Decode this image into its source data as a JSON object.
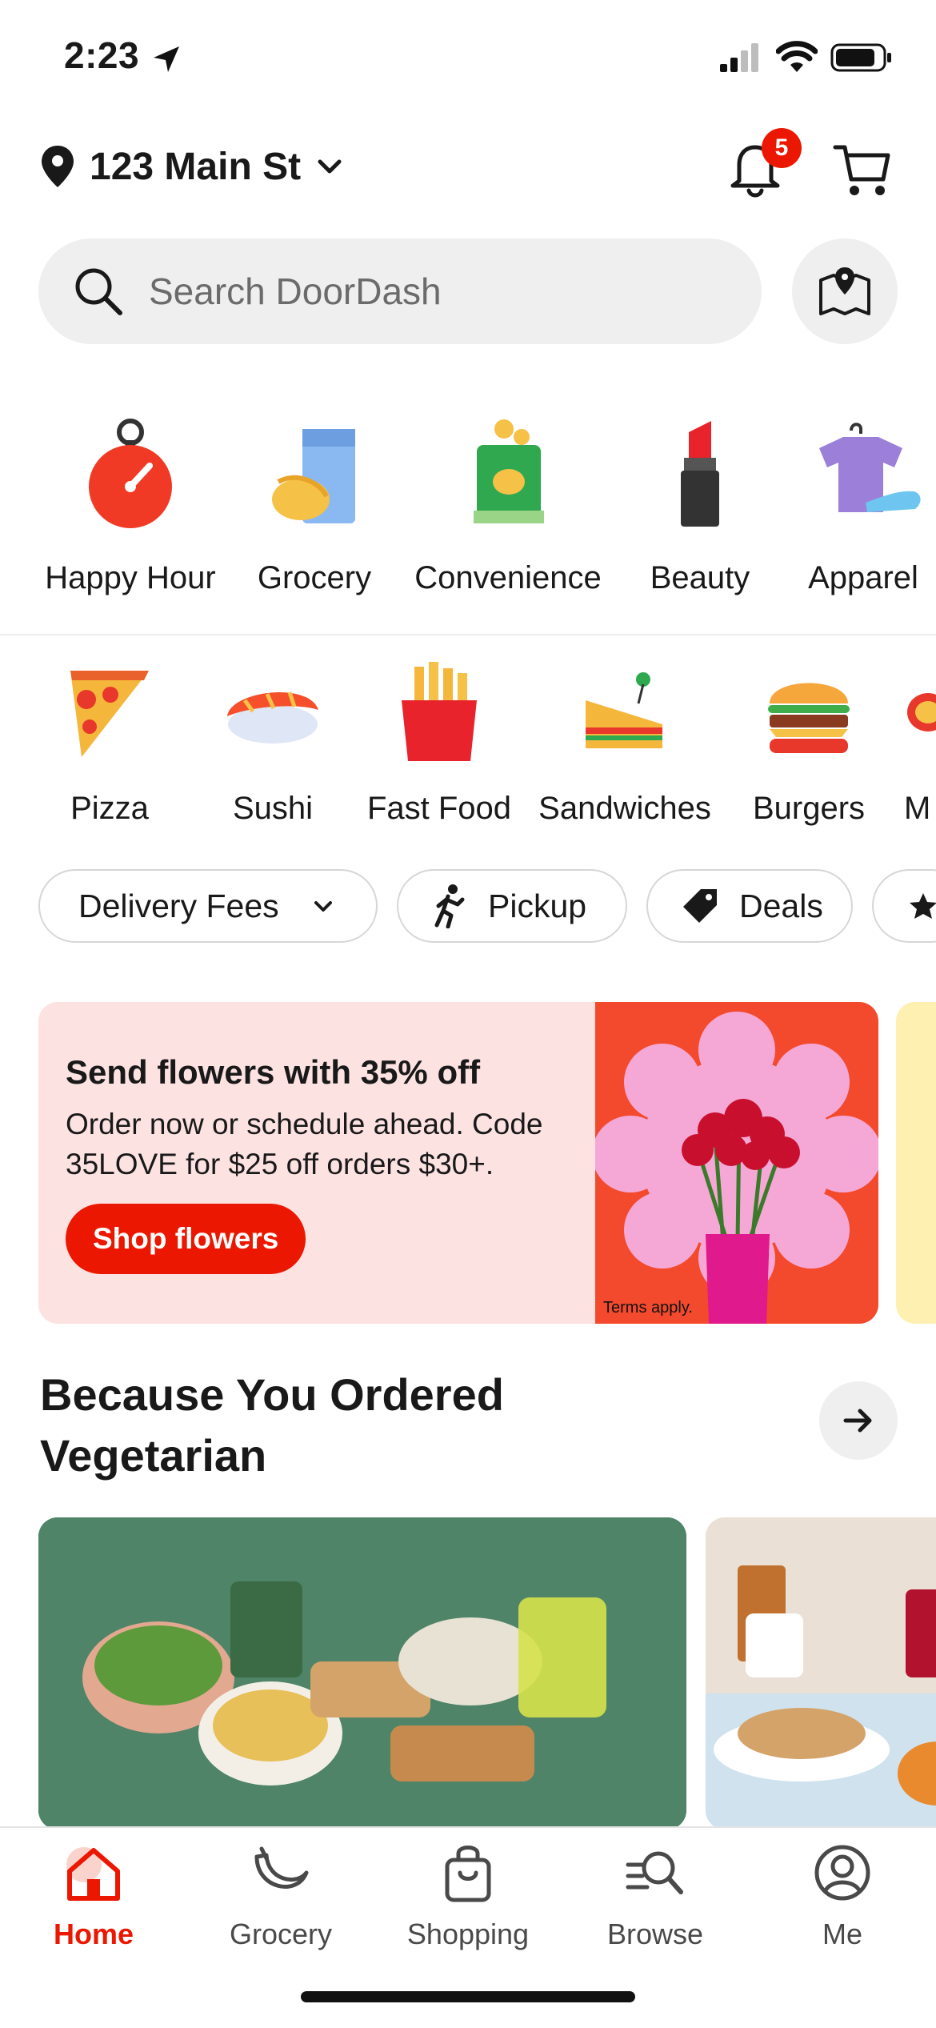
{
  "status_bar": {
    "time": "2:23"
  },
  "header": {
    "address": "123 Main St",
    "notification_count": "5"
  },
  "search": {
    "placeholder": "Search DoorDash"
  },
  "categories": [
    {
      "label": "Happy Hour",
      "icon": "stopwatch-icon"
    },
    {
      "label": "Grocery",
      "icon": "grocery-icon"
    },
    {
      "label": "Convenience",
      "icon": "chips-icon"
    },
    {
      "label": "Beauty",
      "icon": "lipstick-icon"
    },
    {
      "label": "Apparel",
      "icon": "apparel-icon"
    }
  ],
  "cuisines": [
    {
      "label": "Pizza",
      "icon": "pizza-icon"
    },
    {
      "label": "Sushi",
      "icon": "sushi-icon"
    },
    {
      "label": "Fast Food",
      "icon": "fries-icon"
    },
    {
      "label": "Sandwiches",
      "icon": "sandwich-icon"
    },
    {
      "label": "Burgers",
      "icon": "burger-icon"
    },
    {
      "label": "M",
      "icon": "partial-icon"
    }
  ],
  "filters": [
    {
      "label": "Delivery Fees"
    },
    {
      "label": "Pickup"
    },
    {
      "label": "Deals"
    }
  ],
  "promo": {
    "title": "Send flowers with 35% off",
    "body": "Order now or schedule ahead. Code 35LOVE for $25 off orders $30+.",
    "button": "Shop flowers",
    "terms": "Terms apply."
  },
  "section": {
    "title": "Because You Ordered Vegetarian"
  },
  "tabs": [
    {
      "label": "Home",
      "active": true
    },
    {
      "label": "Grocery"
    },
    {
      "label": "Shopping"
    },
    {
      "label": "Browse"
    },
    {
      "label": "Me"
    }
  ],
  "colors": {
    "accent": "#eb1700",
    "chip_border": "#d6d6d6",
    "search_bg": "#efefef"
  }
}
